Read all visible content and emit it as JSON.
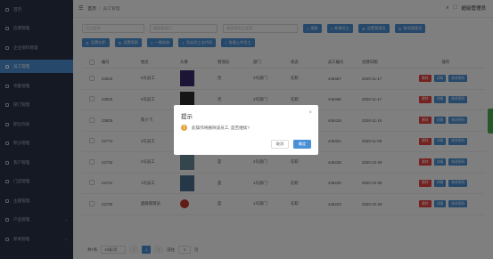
{
  "sidebar": {
    "items": [
      {
        "label": "首页",
        "icon": "home-icon"
      },
      {
        "label": "应聘管理",
        "icon": "document-icon"
      },
      {
        "label": "企业资料管理",
        "icon": "building-icon"
      },
      {
        "label": "员工管理",
        "icon": "user-icon",
        "active": true
      },
      {
        "label": "考勤管理",
        "icon": "clock-icon"
      },
      {
        "label": "部门管理",
        "icon": "department-icon"
      },
      {
        "label": "职位列表",
        "icon": "list-icon"
      },
      {
        "label": "积分管理",
        "icon": "score-icon"
      },
      {
        "label": "客户管理",
        "icon": "customer-icon"
      },
      {
        "label": "门店管理",
        "icon": "store-icon"
      },
      {
        "label": "主题管理",
        "icon": "star-icon"
      },
      {
        "label": "产品管理",
        "icon": "product-icon"
      },
      {
        "label": "新闻管理",
        "icon": "news-icon"
      }
    ]
  },
  "topbar": {
    "breadcrumb_home": "首页",
    "breadcrumb_separator": "/",
    "breadcrumb_current": "员工管理",
    "admin_label": "超级管理员"
  },
  "filters": {
    "name_placeholder": "员工姓名",
    "dept_placeholder": "请选择部门",
    "type_placeholder": "请选择员工类型",
    "search_label": "搜索",
    "add_label": "新增员工",
    "set_admin_label": "设置管理员",
    "cancel_admin_label": "取消管理员"
  },
  "actions": {
    "set_leave": "设置在职",
    "set_quit": "设置离职",
    "one_click_salary": "一键发放",
    "export_salary": "导出员工五代码",
    "batch_import": "批量上传员工"
  },
  "table": {
    "headers": [
      "编号",
      "姓名",
      "头像",
      "管理员",
      "部门",
      "状态",
      "员工编号",
      "创建日期",
      "操作"
    ],
    "rows": [
      {
        "id": "22823",
        "name": "6号员工",
        "admin": "否",
        "dept": "3号部门",
        "status": "在职",
        "emp_no": "446457",
        "date": "2020-11-17"
      },
      {
        "id": "22822",
        "name": "5号员工",
        "admin": "否",
        "dept": "3号部门",
        "status": "在职",
        "emp_no": "446486",
        "date": "2020-11-17"
      },
      {
        "id": "22805",
        "name": "陈小飞",
        "admin": "否",
        "dept": "3号部门",
        "status": "在职",
        "emp_no": "446418",
        "date": "2020-11-16"
      },
      {
        "id": "22774",
        "name": "3号员工",
        "admin": "否",
        "dept": "3号部门",
        "status": "在职",
        "emp_no": "446321",
        "date": "2020-11-09"
      },
      {
        "id": "22732",
        "name": "2号员工",
        "admin": "是",
        "dept": "2号部门",
        "status": "在职",
        "emp_no": "446228",
        "date": "2020-10-29"
      },
      {
        "id": "22731",
        "name": "1号员工",
        "admin": "是",
        "dept": "1号部门",
        "status": "在职",
        "emp_no": "446226",
        "date": "2020-10-29"
      },
      {
        "id": "22730",
        "name": "超级管理员",
        "admin": "是",
        "dept": "1号部门",
        "status": "在职",
        "emp_no": "446223",
        "date": "2020-10-29"
      }
    ],
    "op_delete": "删除",
    "op_edit": "详情",
    "op_more": "修改密码"
  },
  "pager": {
    "total": "共7条",
    "page_size": "10条/页",
    "current_page": "1",
    "goto_prefix": "前往",
    "goto_page": "1",
    "goto_suffix": "页"
  },
  "dialog": {
    "title": "提示",
    "message": "此操作将删除该员工, 是否继续?",
    "cancel": "取消",
    "confirm": "确定"
  },
  "colors": {
    "primary": "#4a90d6",
    "danger": "#e8423f",
    "sidebar": "#2a3346",
    "warning": "#e6a23c"
  }
}
